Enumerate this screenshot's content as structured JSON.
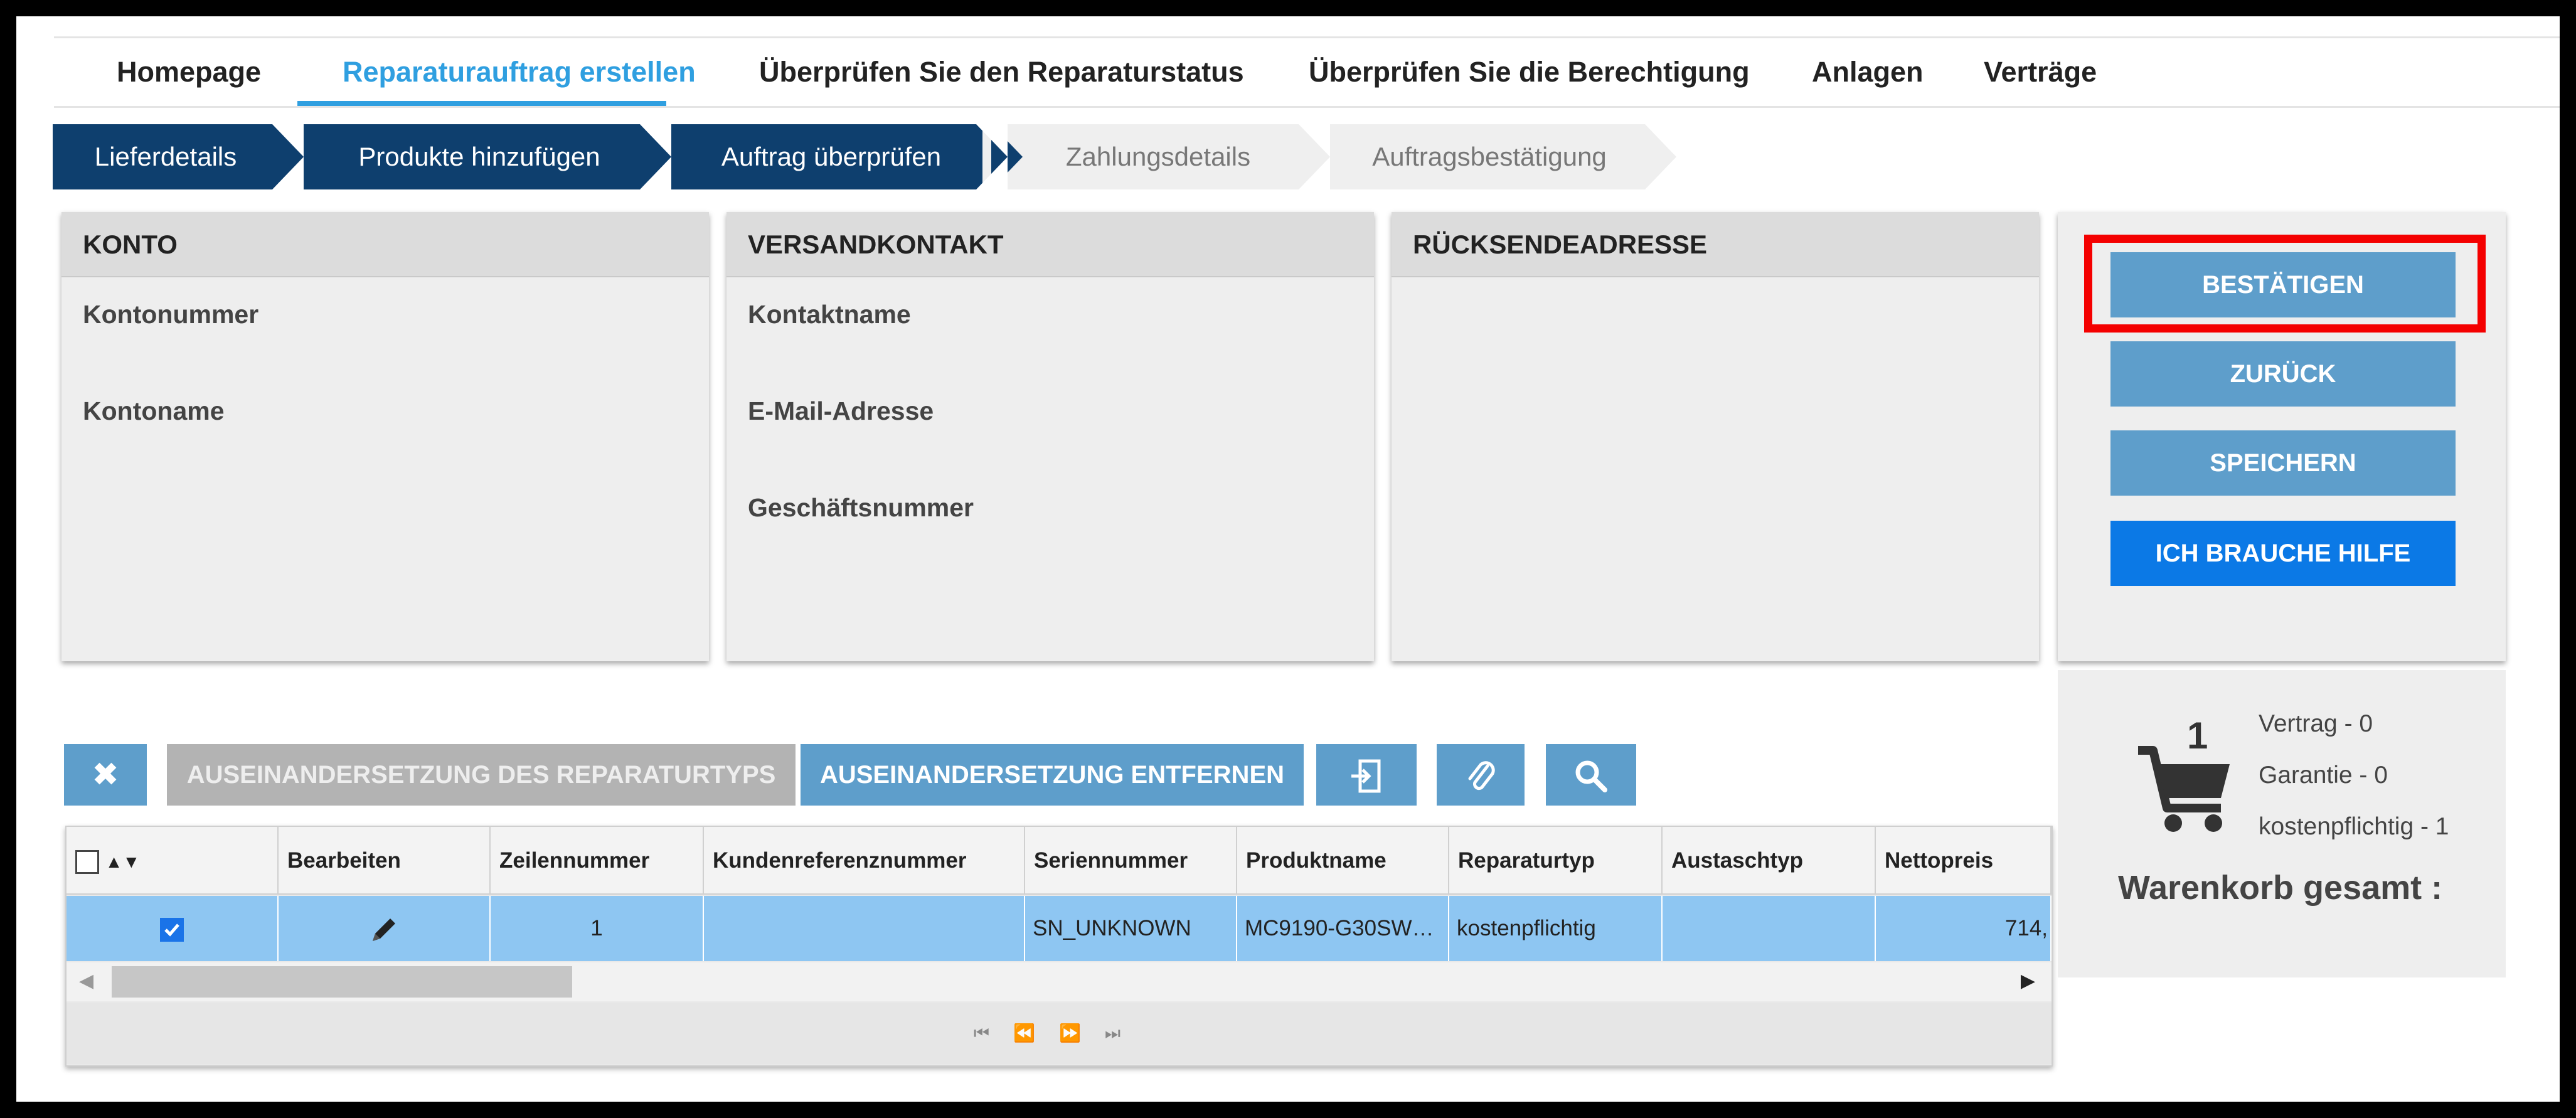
{
  "nav": {
    "items": [
      {
        "label": "Homepage"
      },
      {
        "label": "Reparaturauftrag erstellen"
      },
      {
        "label": "Überprüfen Sie den Reparaturstatus"
      },
      {
        "label": "Überprüfen Sie die Berechtigung"
      },
      {
        "label": "Anlagen"
      },
      {
        "label": "Verträge"
      }
    ],
    "active_index": 1
  },
  "steps": [
    {
      "label": "Lieferdetails",
      "state": "done"
    },
    {
      "label": "Produkte hinzufügen",
      "state": "done"
    },
    {
      "label": "Auftrag überprüfen",
      "state": "current"
    },
    {
      "label": "Zahlungsdetails",
      "state": "todo"
    },
    {
      "label": "Auftragsbestätigung",
      "state": "todo"
    }
  ],
  "panels": {
    "konto": {
      "title": "KONTO",
      "fields": [
        "Kontonummer",
        "Kontoname"
      ]
    },
    "versand": {
      "title": "VERSANDKONTAKT",
      "fields": [
        "Kontaktname",
        "E-Mail-Adresse",
        "Geschäftsnummer"
      ]
    },
    "ruecksende": {
      "title": "RÜCKSENDEADRESSE"
    }
  },
  "actions": {
    "confirm": "BESTÄTIGEN",
    "back": "ZURÜCK",
    "save": "SPEICHERN",
    "help": "ICH BRAUCHE HILFE"
  },
  "summary": {
    "cart_count": "1",
    "vertrag": "Vertrag - 0",
    "garantie": "Garantie - 0",
    "kostenpflichtig": "kostenpflichtig - 1",
    "total_label": "Warenkorb gesamt :"
  },
  "toolbar": {
    "dispute_type": "AUSEINANDERSETZUNG DES REPARATURTYPS",
    "remove_dispute": "AUSEINANDERSETZUNG ENTFERNEN"
  },
  "grid": {
    "headers": [
      "",
      "Bearbeiten",
      "Zeilennummer",
      "Kundenreferenznummer",
      "Seriennummer",
      "Produktname",
      "Reparaturtyp",
      "Austaschtyp",
      "Nettopreis"
    ],
    "rows": [
      {
        "checked": true,
        "line": "1",
        "customer_ref": "",
        "serial": "SN_UNKNOWN",
        "product": "MC9190-G30SW…",
        "repair_type": "kostenpflichtig",
        "exchange_type": "",
        "net_price": "714,"
      }
    ]
  },
  "colors": {
    "accent": "#2f9fe0",
    "step_active": "#0e3f6e",
    "button": "#5e9ecb",
    "help_button": "#0b79e6",
    "highlight": "#f40000",
    "row_selected": "#8ec6f2"
  }
}
